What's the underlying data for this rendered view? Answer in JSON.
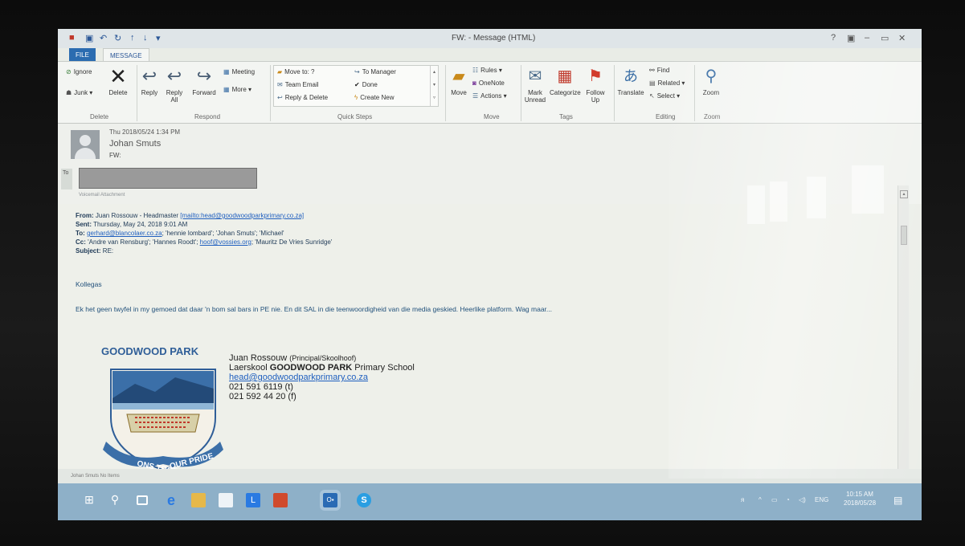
{
  "window": {
    "title": "FW: - Message (HTML)"
  },
  "ribbon": {
    "tabs": [
      "FILE",
      "MESSAGE"
    ],
    "delete_group": {
      "label": "Delete",
      "ignore": "Ignore",
      "junk": "Junk",
      "delete": "Delete"
    },
    "respond_group": {
      "label": "Respond",
      "reply": "Reply",
      "reply_all": "Reply All",
      "forward": "Forward",
      "meeting": "Meeting",
      "more": "More"
    },
    "quick_steps_group": {
      "label": "Quick Steps",
      "move_to": "Move to: ?",
      "team_email": "Team Email",
      "reply_delete": "Reply & Delete",
      "to_manager": "To Manager",
      "done": "Done",
      "create_new": "Create New"
    },
    "move_group": {
      "label": "Move",
      "move": "Move",
      "rules": "Rules",
      "onenote": "OneNote",
      "actions": "Actions"
    },
    "tags_group": {
      "label": "Tags",
      "mark_unread": "Mark Unread",
      "categorize": "Categorize",
      "follow_up": "Follow Up"
    },
    "editing_group": {
      "label": "Editing",
      "translate": "Translate",
      "find": "Find",
      "related": "Related",
      "select": "Select"
    },
    "zoom_group": {
      "label": "Zoom",
      "zoom": "Zoom"
    }
  },
  "header": {
    "date": "Thu 2018/05/24 1:34 PM",
    "sender": "Johan Smuts",
    "subject": "FW:",
    "to_label": "To",
    "remove_label": "Voicemail Attachment"
  },
  "email": {
    "from_label": "From:",
    "from_name": "Juan Rossouw - Headmaster",
    "from_mailto": "[mailto:head@goodwoodparkprimary.co.za]",
    "sent_label": "Sent:",
    "sent": "Thursday, May 24, 2018 9:01 AM",
    "to_label": "To:",
    "to_link": "gerhard@blancolaer.co.za",
    "to_rest": "; 'hennie lombard'; 'Johan Smuts'; 'Michael'",
    "cc_label": "Cc:",
    "cc_start": "'Andre van Rensburg'; 'Hannes Roodt'; ",
    "cc_link": "hoof@vossies.org",
    "cc_rest": "; 'Mauritz De Vries Sunridge'",
    "subject_label": "Subject:",
    "subject": "RE:",
    "greeting": "Kollegas",
    "message": "Ek het geen twyfel in my gemoed dat daar 'n bom sal bars in PE nie.  En dit SAL in die teenwoordigheid van die media geskied.  Heerlike platform.  Wag maar..."
  },
  "signature": {
    "logo_title": "GOODWOOD PARK",
    "motto_left": "ONS TROTS",
    "motto_right": "OUR PRIDE",
    "name": "Juan Rossouw",
    "role": "(Principal/Skoolhoof)",
    "school_prefix": "Laerskool ",
    "school_bold": "GOODWOOD PARK",
    "school_suffix": " Primary School",
    "email": "head@goodwoodparkprimary.co.za",
    "phone": "021 591 6119 (t)",
    "fax": "021 592 44 20 (f)"
  },
  "status_bar": {
    "text": "Johan Smuts  No Items"
  },
  "taskbar": {
    "apps": [
      "start",
      "search",
      "task-view",
      "edge",
      "file-explorer",
      "store",
      "lync",
      "office",
      "outlook",
      "skype"
    ],
    "tray_lang": "ENG",
    "clock_time": "10:15 AM",
    "clock_date": "2018/05/28"
  },
  "colors": {
    "accent": "#2b6cb0",
    "taskbar": "#8eb0c8",
    "link": "#1f5fbf"
  }
}
